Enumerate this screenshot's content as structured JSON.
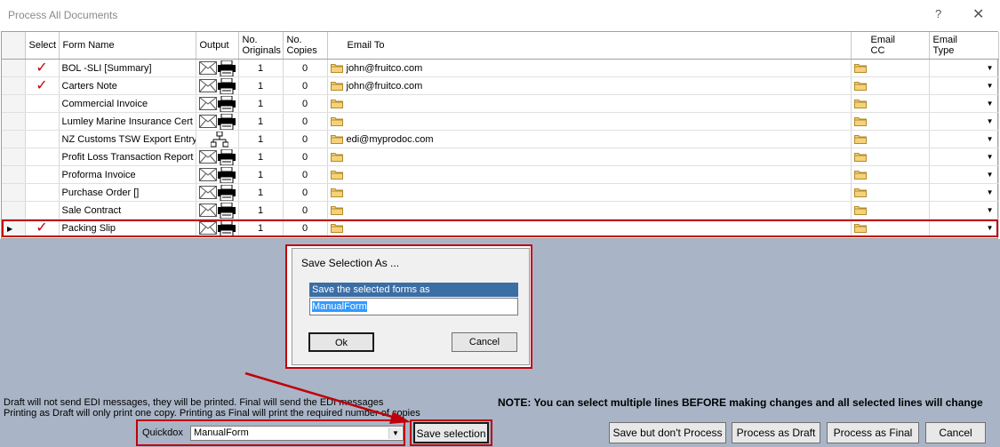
{
  "window": {
    "title": "Process All Documents",
    "help_glyph": "?",
    "close_glyph": "✕"
  },
  "grid": {
    "headers": {
      "select": "Select",
      "form_name": "Form Name",
      "output": "Output",
      "no_originals_1": "No.",
      "no_originals_2": "Originals",
      "no_copies_1": "No.",
      "no_copies_2": "Copies",
      "email_to": "Email To",
      "email_cc_1": "Email",
      "email_cc_2": "CC",
      "email_type_1": "Email",
      "email_type_2": "Type"
    },
    "rows": [
      {
        "selected": true,
        "name": "BOL -SLI [Summary]",
        "output": "email-print",
        "originals": "1",
        "copies": "0",
        "email_to": "john@fruitco.com"
      },
      {
        "selected": true,
        "name": "Carters Note",
        "output": "email-print",
        "originals": "1",
        "copies": "0",
        "email_to": "john@fruitco.com"
      },
      {
        "selected": false,
        "name": "Commercial Invoice",
        "output": "email-print",
        "originals": "1",
        "copies": "0",
        "email_to": ""
      },
      {
        "selected": false,
        "name": "Lumley Marine Insurance Cert",
        "output": "email-print",
        "originals": "1",
        "copies": "0",
        "email_to": ""
      },
      {
        "selected": false,
        "name": "NZ Customs TSW Export Entry",
        "output": "edi",
        "originals": "1",
        "copies": "0",
        "email_to": "edi@myprodoc.com"
      },
      {
        "selected": false,
        "name": "Profit Loss Transaction Report",
        "output": "email-print",
        "originals": "1",
        "copies": "0",
        "email_to": ""
      },
      {
        "selected": false,
        "name": "Proforma Invoice",
        "output": "email-print",
        "originals": "1",
        "copies": "0",
        "email_to": ""
      },
      {
        "selected": false,
        "name": "Purchase Order []",
        "output": "email-print",
        "originals": "1",
        "copies": "0",
        "email_to": ""
      },
      {
        "selected": false,
        "name": "Sale Contract",
        "output": "email-print",
        "originals": "1",
        "copies": "0",
        "email_to": ""
      },
      {
        "selected": true,
        "name": "Packing Slip",
        "output": "email-print",
        "originals": "1",
        "copies": "0",
        "email_to": "",
        "current": true
      }
    ]
  },
  "dialog": {
    "title": "Save Selection As ...",
    "label": "Save the selected forms as",
    "value": "ManualForm",
    "ok_label": "Ok",
    "cancel_label": "Cancel"
  },
  "bottom": {
    "info_line1": "Draft will not send EDI messages, they will be printed.  Final will send the EDI messages",
    "info_line2": "Printing as Draft will only print one copy.  Printing as Final will print the required number of copies",
    "note": "NOTE:  You can select multiple lines BEFORE making changes and all selected lines will change",
    "quickdox_label": "Quickdox",
    "quickdox_value": "ManualForm",
    "save_selection_label": "Save selection",
    "save_no_process_label": "Save but don't Process",
    "process_draft_label": "Process as Draft",
    "process_final_label": "Process as Final",
    "cancel_label": "Cancel"
  },
  "colors": {
    "highlight": "#c0000a",
    "background": "#a9b5c6",
    "dialog_label_bg": "#3b6ea5"
  }
}
